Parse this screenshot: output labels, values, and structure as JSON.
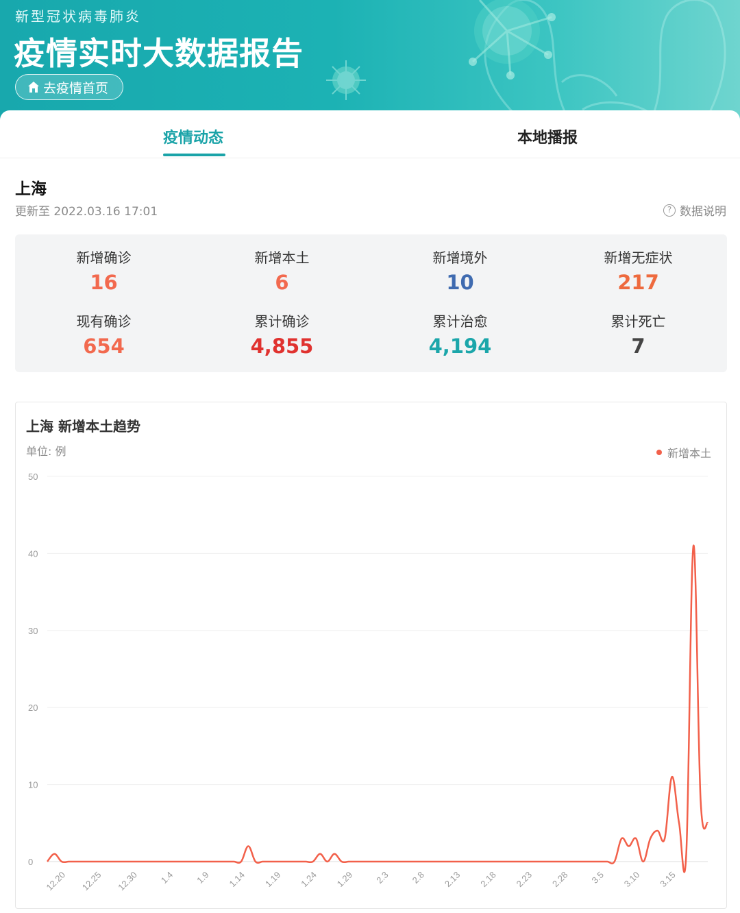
{
  "header": {
    "subtitle": "新型冠状病毒肺炎",
    "title": "疫情实时大数据报告",
    "home_button": "去疫情首页"
  },
  "tabs": [
    {
      "label": "疫情动态",
      "active": true
    },
    {
      "label": "本地播报",
      "active": false
    }
  ],
  "region": {
    "name": "上海",
    "updated": "更新至 2022.03.16 17:01",
    "data_note": "数据说明"
  },
  "stats": [
    {
      "label": "新增确诊",
      "value": "16",
      "color": "#f2694e"
    },
    {
      "label": "新增本土",
      "value": "6",
      "color": "#f2694e"
    },
    {
      "label": "新增境外",
      "value": "10",
      "color": "#3f6bb0"
    },
    {
      "label": "新增无症状",
      "value": "217",
      "color": "#ee6a3e"
    },
    {
      "label": "现有确诊",
      "value": "654",
      "color": "#f2694e"
    },
    {
      "label": "累计确诊",
      "value": "4,855",
      "color": "#e0322f"
    },
    {
      "label": "累计治愈",
      "value": "4,194",
      "color": "#1ba6aa"
    },
    {
      "label": "累计死亡",
      "value": "7",
      "color": "#444444"
    }
  ],
  "chart_data": {
    "type": "line",
    "title": "上海 新增本土趋势",
    "unit": "单位: 例",
    "legend": "新增本土",
    "legend_position": "top-right",
    "color": "#f2604a",
    "ylim": [
      0,
      50
    ],
    "yticks": [
      0,
      10,
      20,
      30,
      40,
      50
    ],
    "grid": true,
    "x_tick_labels": [
      "12.20",
      "12.25",
      "12.30",
      "1.4",
      "1.9",
      "1.14",
      "1.19",
      "1.24",
      "1.29",
      "2.3",
      "2.8",
      "2.13",
      "2.18",
      "2.23",
      "2.28",
      "3.5",
      "3.10",
      "3.15"
    ],
    "x_start": "12.20",
    "x": [
      "12.18",
      "12.19",
      "12.20",
      "12.21",
      "12.22",
      "12.23",
      "12.24",
      "12.25",
      "12.26",
      "12.27",
      "12.28",
      "12.29",
      "12.30",
      "12.31",
      "1.1",
      "1.2",
      "1.3",
      "1.4",
      "1.5",
      "1.6",
      "1.7",
      "1.8",
      "1.9",
      "1.10",
      "1.11",
      "1.12",
      "1.13",
      "1.14",
      "1.15",
      "1.16",
      "1.17",
      "1.18",
      "1.19",
      "1.20",
      "1.21",
      "1.22",
      "1.23",
      "1.24",
      "1.25",
      "1.26",
      "1.27",
      "1.28",
      "1.29",
      "1.30",
      "1.31",
      "2.1",
      "2.2",
      "2.3",
      "2.4",
      "2.5",
      "2.6",
      "2.7",
      "2.8",
      "2.9",
      "2.10",
      "2.11",
      "2.12",
      "2.13",
      "2.14",
      "2.15",
      "2.16",
      "2.17",
      "2.18",
      "2.19",
      "2.20",
      "2.21",
      "2.22",
      "2.23",
      "2.24",
      "2.25",
      "2.26",
      "2.27",
      "2.28",
      "3.1",
      "3.2",
      "3.3",
      "3.4",
      "3.5",
      "3.6",
      "3.7",
      "3.8",
      "3.9",
      "3.10",
      "3.11",
      "3.12",
      "3.13",
      "3.14",
      "3.15",
      "3.16"
    ],
    "values": [
      0,
      1,
      0,
      0,
      0,
      0,
      0,
      0,
      0,
      0,
      0,
      0,
      0,
      0,
      0,
      0,
      0,
      0,
      0,
      0,
      0,
      0,
      0,
      0,
      0,
      0,
      0,
      0,
      2,
      0,
      0,
      0,
      0,
      0,
      0,
      0,
      0,
      0,
      1,
      0,
      1,
      0,
      0,
      0,
      0,
      0,
      0,
      0,
      0,
      0,
      0,
      0,
      0,
      0,
      0,
      0,
      0,
      0,
      0,
      0,
      0,
      0,
      0,
      0,
      0,
      0,
      0,
      0,
      0,
      0,
      0,
      0,
      0,
      0,
      0,
      0,
      0,
      0,
      0,
      0,
      3,
      2,
      3,
      0,
      3,
      4,
      3,
      11,
      5,
      1,
      41,
      8,
      5
    ]
  }
}
